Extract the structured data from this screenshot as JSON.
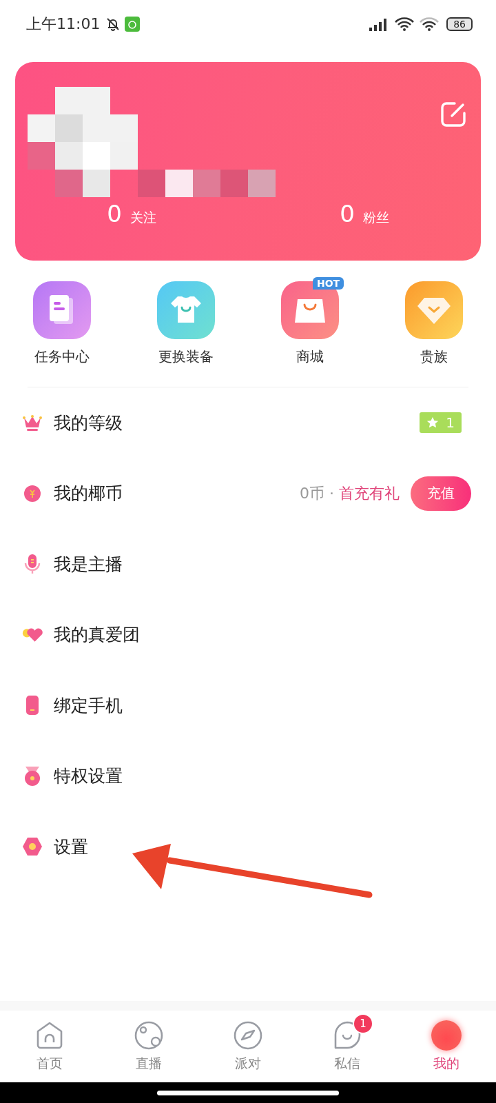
{
  "status_bar": {
    "time": "上午11:01",
    "battery": "86"
  },
  "profile_card": {
    "stats": [
      {
        "value": "0",
        "label": "关注"
      },
      {
        "value": "0",
        "label": "粉丝"
      }
    ]
  },
  "shortcuts": [
    {
      "label": "任务中心"
    },
    {
      "label": "更换装备"
    },
    {
      "label": "商城",
      "badge": "HOT"
    },
    {
      "label": "贵族"
    }
  ],
  "menu": [
    {
      "label": "我的等级",
      "trailing": {
        "kind": "level",
        "value": "1"
      }
    },
    {
      "label": "我的椰币",
      "trailing": {
        "kind": "coins",
        "balance": "0币 · ",
        "promo": "首充有礼",
        "button": "充值"
      }
    },
    {
      "label": "我是主播"
    },
    {
      "label": "我的真爱团"
    },
    {
      "label": "绑定手机"
    },
    {
      "label": "特权设置"
    },
    {
      "label": "设置"
    }
  ],
  "tab_bar": [
    {
      "label": "首页",
      "selected": false
    },
    {
      "label": "直播",
      "selected": false
    },
    {
      "label": "派对",
      "selected": false
    },
    {
      "label": "私信",
      "selected": false,
      "badge": "1"
    },
    {
      "label": "我的",
      "selected": true
    }
  ]
}
